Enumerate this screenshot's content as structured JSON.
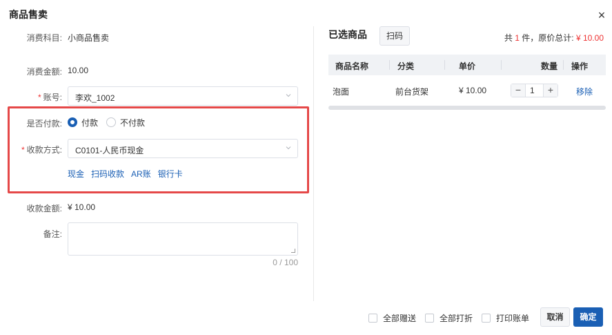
{
  "dialog": {
    "title": "商品售卖",
    "close": "×"
  },
  "form": {
    "subject_label": "消费科目:",
    "subject_value": "小商品售卖",
    "amount_label": "消费金额:",
    "amount_value": "10.00",
    "account_label": "账号:",
    "account_value": "李欢_1002",
    "pay_label": "是否付款:",
    "pay_options": [
      "付款",
      "不付款"
    ],
    "pay_selected": "付款",
    "method_label": "收款方式:",
    "method_value": "C0101-人民币现金",
    "quick_methods": [
      "现金",
      "扫码收款",
      "AR账",
      "银行卡"
    ],
    "received_label": "收款金额:",
    "received_value": "¥ 10.00",
    "remark_label": "备注:",
    "remark_value": "",
    "remark_counter": "0 / 100"
  },
  "panel": {
    "title": "已选商品",
    "scan_label": "扫码",
    "summary_prefix": "共",
    "summary_count": "1",
    "summary_mid": "件，原价总计:",
    "summary_total": "¥ 10.00",
    "columns": [
      "商品名称",
      "分类",
      "单价",
      "数量",
      "操作"
    ],
    "rows": [
      {
        "name": "泡面",
        "category": "前台货架",
        "price": "¥ 10.00",
        "qty": "1",
        "action": "移除"
      }
    ]
  },
  "footer": {
    "options": [
      "全部赠送",
      "全部打折",
      "打印账单"
    ],
    "cancel_label": "取消",
    "ok_label": "确定"
  },
  "colors": {
    "primary": "#1a5fb4",
    "required": "#e33333",
    "highlight_box": "#e54848"
  }
}
